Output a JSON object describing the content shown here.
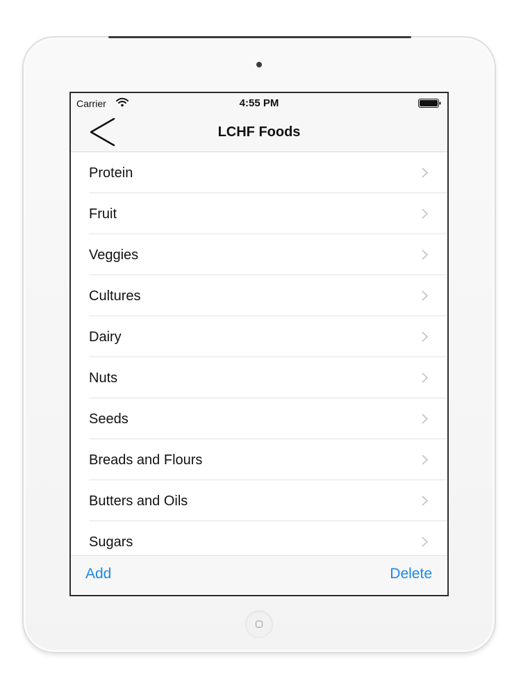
{
  "status_bar": {
    "carrier": "Carrier",
    "time": "4:55 PM",
    "wifi_icon": "wifi-icon",
    "battery_icon": "battery-full-icon"
  },
  "nav": {
    "back_icon": "chevron-left-icon",
    "title": "LCHF Foods"
  },
  "list": {
    "items": [
      {
        "label": "Protein"
      },
      {
        "label": "Fruit"
      },
      {
        "label": "Veggies"
      },
      {
        "label": "Cultures"
      },
      {
        "label": "Dairy"
      },
      {
        "label": "Nuts"
      },
      {
        "label": "Seeds"
      },
      {
        "label": "Breads and Flours"
      },
      {
        "label": "Butters and Oils"
      },
      {
        "label": "Sugars"
      }
    ],
    "row_icon": "chevron-right-icon"
  },
  "toolbar": {
    "add_label": "Add",
    "delete_label": "Delete"
  },
  "colors": {
    "accent": "#1e88e5",
    "text": "#111111",
    "separator": "#e3e3e3",
    "bar_background": "#f7f7f7",
    "device_frame": "#f3f3f3"
  }
}
